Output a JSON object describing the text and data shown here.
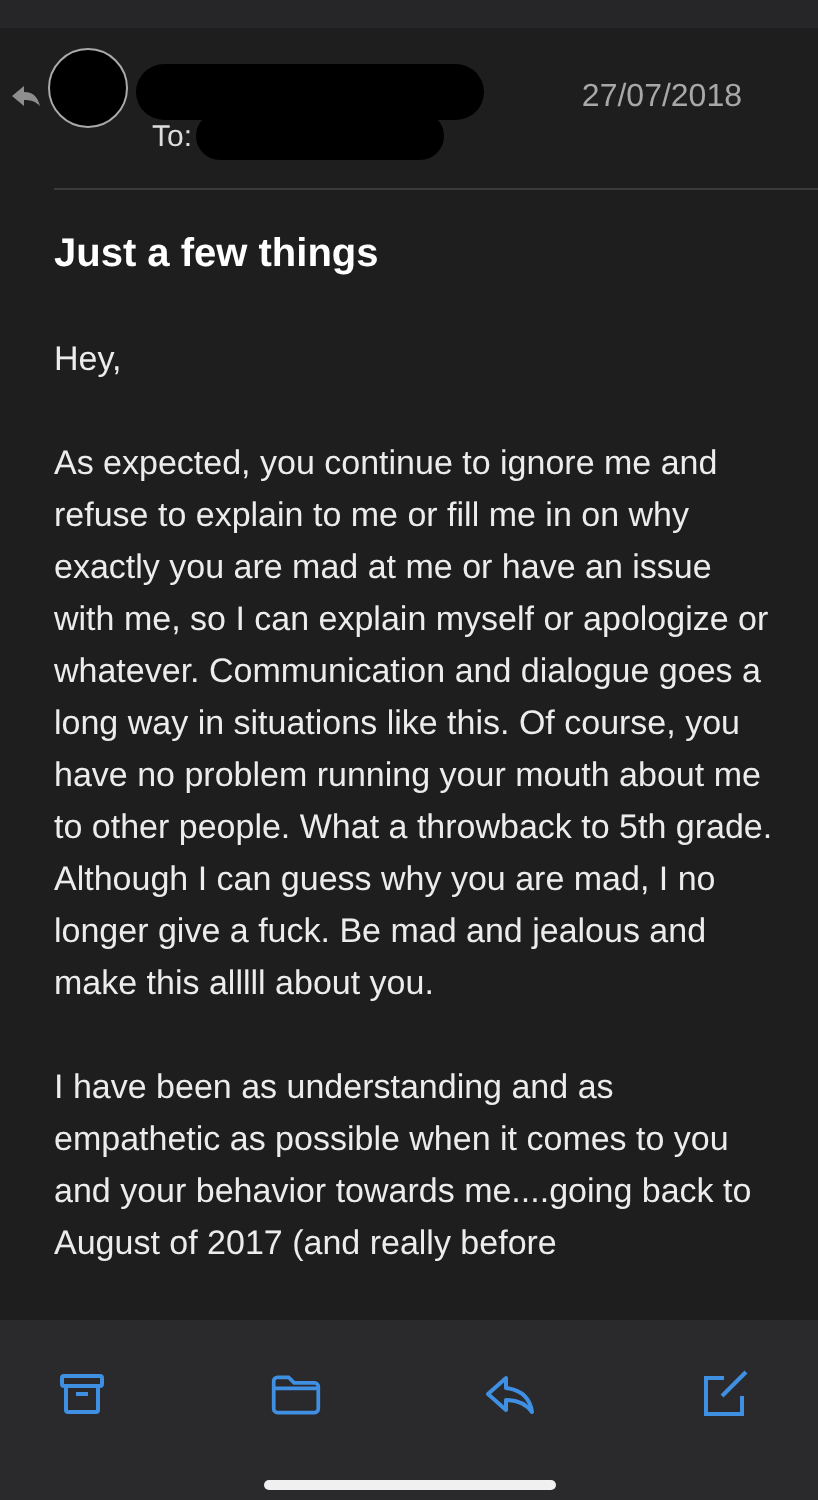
{
  "header": {
    "to_label": "To:",
    "date": "27/07/2018",
    "replied": true
  },
  "subject": "Just a few things",
  "body": [
    "Hey,",
    "As expected, you continue to ignore me and refuse to explain to me or fill me in on why exactly you are mad at me or have an issue with me, so I can explain myself or apologize or whatever. Communication and dialogue goes a long way in situations like this. Of course, you have no problem running your mouth about me to other people. What a throwback to 5th grade. Although I can guess why you are mad, I no longer give a fuck. Be mad and jealous and make this alllll about you.",
    "I have been as understanding and as empathetic as possible when it comes to you and your behavior towards me....going back to August of 2017 (and really before"
  ],
  "toolbar": [
    {
      "kind": "archive"
    },
    {
      "kind": "folder"
    },
    {
      "kind": "reply"
    },
    {
      "kind": "compose"
    }
  ]
}
